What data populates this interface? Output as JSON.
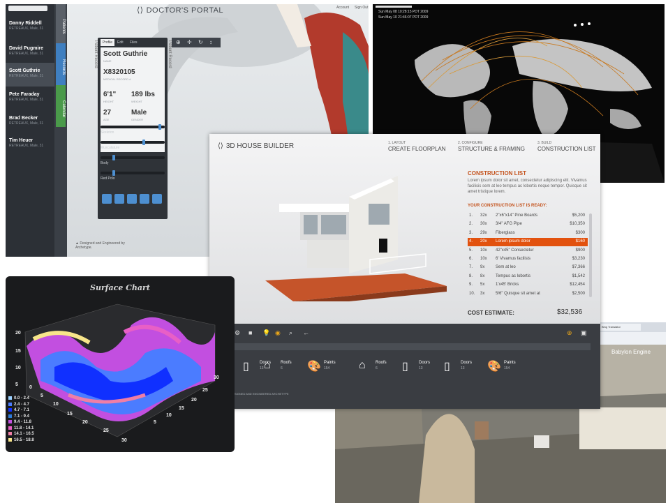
{
  "doctor_portal": {
    "title": "DOCTOR'S PORTAL",
    "top_links": [
      "Account",
      "Sign Out"
    ],
    "side_tabs": [
      "Patients",
      "Records",
      "Calendar"
    ],
    "patients": [
      {
        "name": "Danny Riddell",
        "detail": "RETREAUX, Male, 31"
      },
      {
        "name": "David Pugmire",
        "detail": "RETREAUX, Male, 31"
      },
      {
        "name": "Scott Guthrie",
        "detail": "RETREAUX, Male, 31"
      },
      {
        "name": "Pete Faraday",
        "detail": "RETREAUX, Male, 31"
      },
      {
        "name": "Brad Becker",
        "detail": "RETREAUX, Male, 31"
      },
      {
        "name": "Tim Heuer",
        "detail": "RETREAUX, Male, 31"
      }
    ],
    "card_tabs": [
      "Profile",
      "Edit",
      "Files"
    ],
    "patient_record_label": "Patient Record",
    "profile": {
      "name": "Scott Guthrie",
      "name_caption": "NAME",
      "id": "X8320105",
      "id_caption": "MEDICAL RECORD #",
      "height": "6'1\"",
      "height_caption": "HEIGHT",
      "weight": "189 lbs",
      "weight_caption": "WEIGHT",
      "age": "27",
      "age_caption": "AGE",
      "gender": "Male",
      "gender_caption": "GENDER"
    },
    "layers": [
      "Skeleton",
      "Musculature",
      "Body",
      "Red Polo"
    ],
    "layer_levels": [
      0.97,
      0.7,
      0.2,
      0.2
    ],
    "footer": "Designed and Engineered by Archetype."
  },
  "world_map": {
    "timestamps": [
      "Sun May 08 10:28:15 PDT 2009",
      "Sun May 10 21:46:07 PDT 2009"
    ]
  },
  "house_builder": {
    "title": "3D HOUSE BUILDER",
    "steps": [
      {
        "num": "1. LAYOUT",
        "label": "CREATE FLOORPLAN"
      },
      {
        "num": "2. CONFIGURE",
        "label": "STRUCTURE & FRAMING"
      },
      {
        "num": "3. BUILD",
        "label": "CONSTRUCTION LIST"
      }
    ],
    "list_title": "CONSTRUCTION LIST",
    "list_intro": "Lorem ipsum dolor sit amet, consectetur adipiscing elit. Vivamus facilisis sem at leo tempus ac lobortis neque tempor. Quisque sit amet tristique lorem.",
    "ready_label": "YOUR CONSTRUCTION LIST IS READY:",
    "items": [
      {
        "n": "1.",
        "qty": "32x",
        "desc": "2\"x6\"x14\" Pine Boards",
        "price": "$5,200"
      },
      {
        "n": "2.",
        "qty": "30x",
        "desc": "3/4\" AFG Pipe",
        "price": "$10,350"
      },
      {
        "n": "3.",
        "qty": "29x",
        "desc": "Fiberglass",
        "price": "$300"
      },
      {
        "n": "4.",
        "qty": "20x",
        "desc": "Lorem ipsum dolor",
        "price": "$160"
      },
      {
        "n": "5.",
        "qty": "10x",
        "desc": "42\"x45\" Consectetur",
        "price": "$900"
      },
      {
        "n": "6.",
        "qty": "10x",
        "desc": "6' Vivamus facilisis",
        "price": "$3,230"
      },
      {
        "n": "7.",
        "qty": "9x",
        "desc": "Sem at leo",
        "price": "$7,366"
      },
      {
        "n": "8.",
        "qty": "8x",
        "desc": "Tempus ac lobortis",
        "price": "$1,542"
      },
      {
        "n": "9.",
        "qty": "5x",
        "desc": "1'x45' Bricks",
        "price": "$12,454"
      },
      {
        "n": "10.",
        "qty": "3x",
        "desc": "5/6\" Quisque sit amet at",
        "price": "$2,500"
      }
    ],
    "highlighted_item": 3,
    "cost_label": "COST ESTIMATE:",
    "cost_value": "$32,536",
    "categories": [
      {
        "name": "Doors",
        "count": "13"
      },
      {
        "name": "Roofs",
        "count": "6"
      },
      {
        "name": "Paints",
        "count": "154"
      },
      {
        "name": "Roofs",
        "count": "6"
      },
      {
        "name": "Doors",
        "count": "13"
      },
      {
        "name": "Doors",
        "count": "13"
      },
      {
        "name": "Paints",
        "count": "154"
      }
    ],
    "footer": "SIGNED AND ENGINEERED ARCHETYPE"
  },
  "surface_chart": {
    "title": "Surface Chart",
    "legend": [
      "0.0 - 2.4",
      "2.4 - 4.7",
      "4.7 - 7.1",
      "7.1 - 9.4",
      "9.4 - 11.8",
      "11.8 - 14.1",
      "14.1 - 16.5",
      "16.5 - 18.8"
    ],
    "legend_colors": [
      "#9bd1ff",
      "#4b7cff",
      "#1030ff",
      "#2e7bd8",
      "#c24fe0",
      "#e85fc6",
      "#f07ea6",
      "#f7e58a"
    ],
    "z_ticks": [
      "20",
      "15",
      "10",
      "5"
    ],
    "x_ticks": [
      "0",
      "5",
      "10",
      "15",
      "20",
      "25",
      "30"
    ],
    "y_ticks": [
      "30",
      "25",
      "20",
      "15",
      "10",
      "5"
    ]
  },
  "babylon": {
    "title": "Babylon Engine",
    "tab_label": "Bing Translator"
  }
}
